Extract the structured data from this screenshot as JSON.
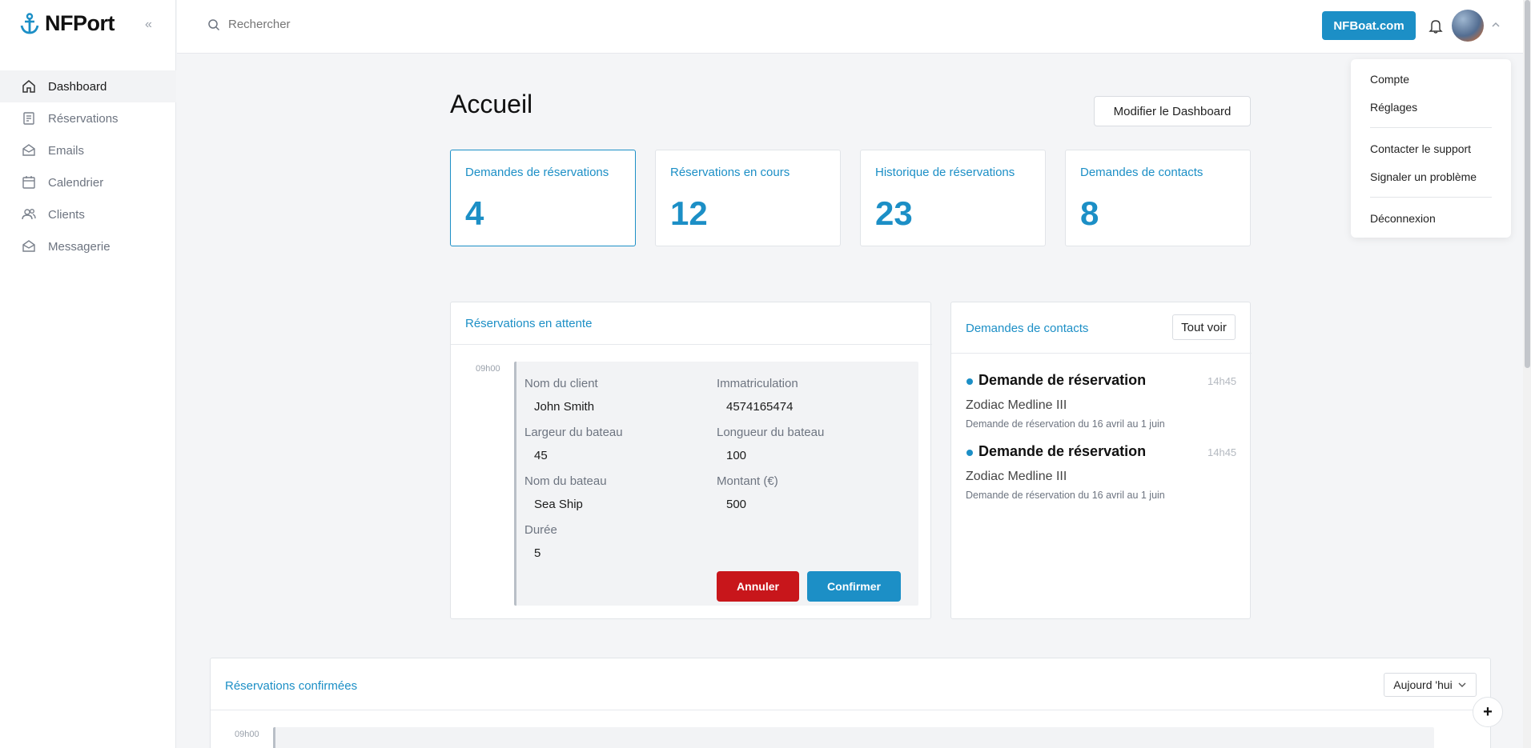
{
  "app": {
    "name": "NFPort"
  },
  "sidebar": {
    "items": [
      {
        "label": "Dashboard",
        "icon": "home-icon",
        "active": true
      },
      {
        "label": "Réservations",
        "icon": "document-icon"
      },
      {
        "label": "Emails",
        "icon": "envelope-icon"
      },
      {
        "label": "Calendrier",
        "icon": "calendar-icon"
      },
      {
        "label": "Clients",
        "icon": "users-icon"
      },
      {
        "label": "Messagerie",
        "icon": "mail-open-icon"
      }
    ]
  },
  "header": {
    "search_placeholder": "Rechercher",
    "external_link": "NFBoat.com"
  },
  "user_menu": {
    "items": [
      "Compte",
      "Réglages",
      "Contacter le support",
      "Signaler un problème",
      "Déconnexion"
    ]
  },
  "page": {
    "title": "Accueil",
    "modify_button": "Modifier le Dashboard"
  },
  "stats": [
    {
      "label": "Demandes de réservations",
      "value": "4"
    },
    {
      "label": "Réservations en cours",
      "value": "12"
    },
    {
      "label": "Historique de réservations",
      "value": "23"
    },
    {
      "label": "Demandes de contacts",
      "value": "8"
    }
  ],
  "pending": {
    "title": "Réservations en attente",
    "time": "09h00",
    "fields": {
      "client_label": "Nom du client",
      "client": "John Smith",
      "reg_label": "Immatriculation",
      "reg": "4574165474",
      "width_label": "Largeur du bateau",
      "width": "45",
      "length_label": "Longueur du bateau",
      "length": "100",
      "boat_label": "Nom du bateau",
      "boat": "Sea Ship",
      "amount_label": "Montant (€)",
      "amount": "500",
      "duration_label": "Durée",
      "duration": "5"
    },
    "cancel": "Annuler",
    "confirm": "Confirmer"
  },
  "contacts": {
    "title": "Demandes de contacts",
    "see_all": "Tout voir",
    "items": [
      {
        "title": "Demande de réservation",
        "time": "14h45",
        "boat": "Zodiac Medline III",
        "desc": "Demande de réservation du 16 avril au 1 juin"
      },
      {
        "title": "Demande de réservation",
        "time": "14h45",
        "boat": "Zodiac Medline III",
        "desc": "Demande de réservation du 16 avril au 1 juin"
      }
    ]
  },
  "confirmed": {
    "title": "Réservations confirmées",
    "filter": "Aujourd 'hui",
    "time": "09h00",
    "fab": "+"
  },
  "colors": {
    "accent": "#1c8fc6",
    "danger": "#c8161b"
  }
}
